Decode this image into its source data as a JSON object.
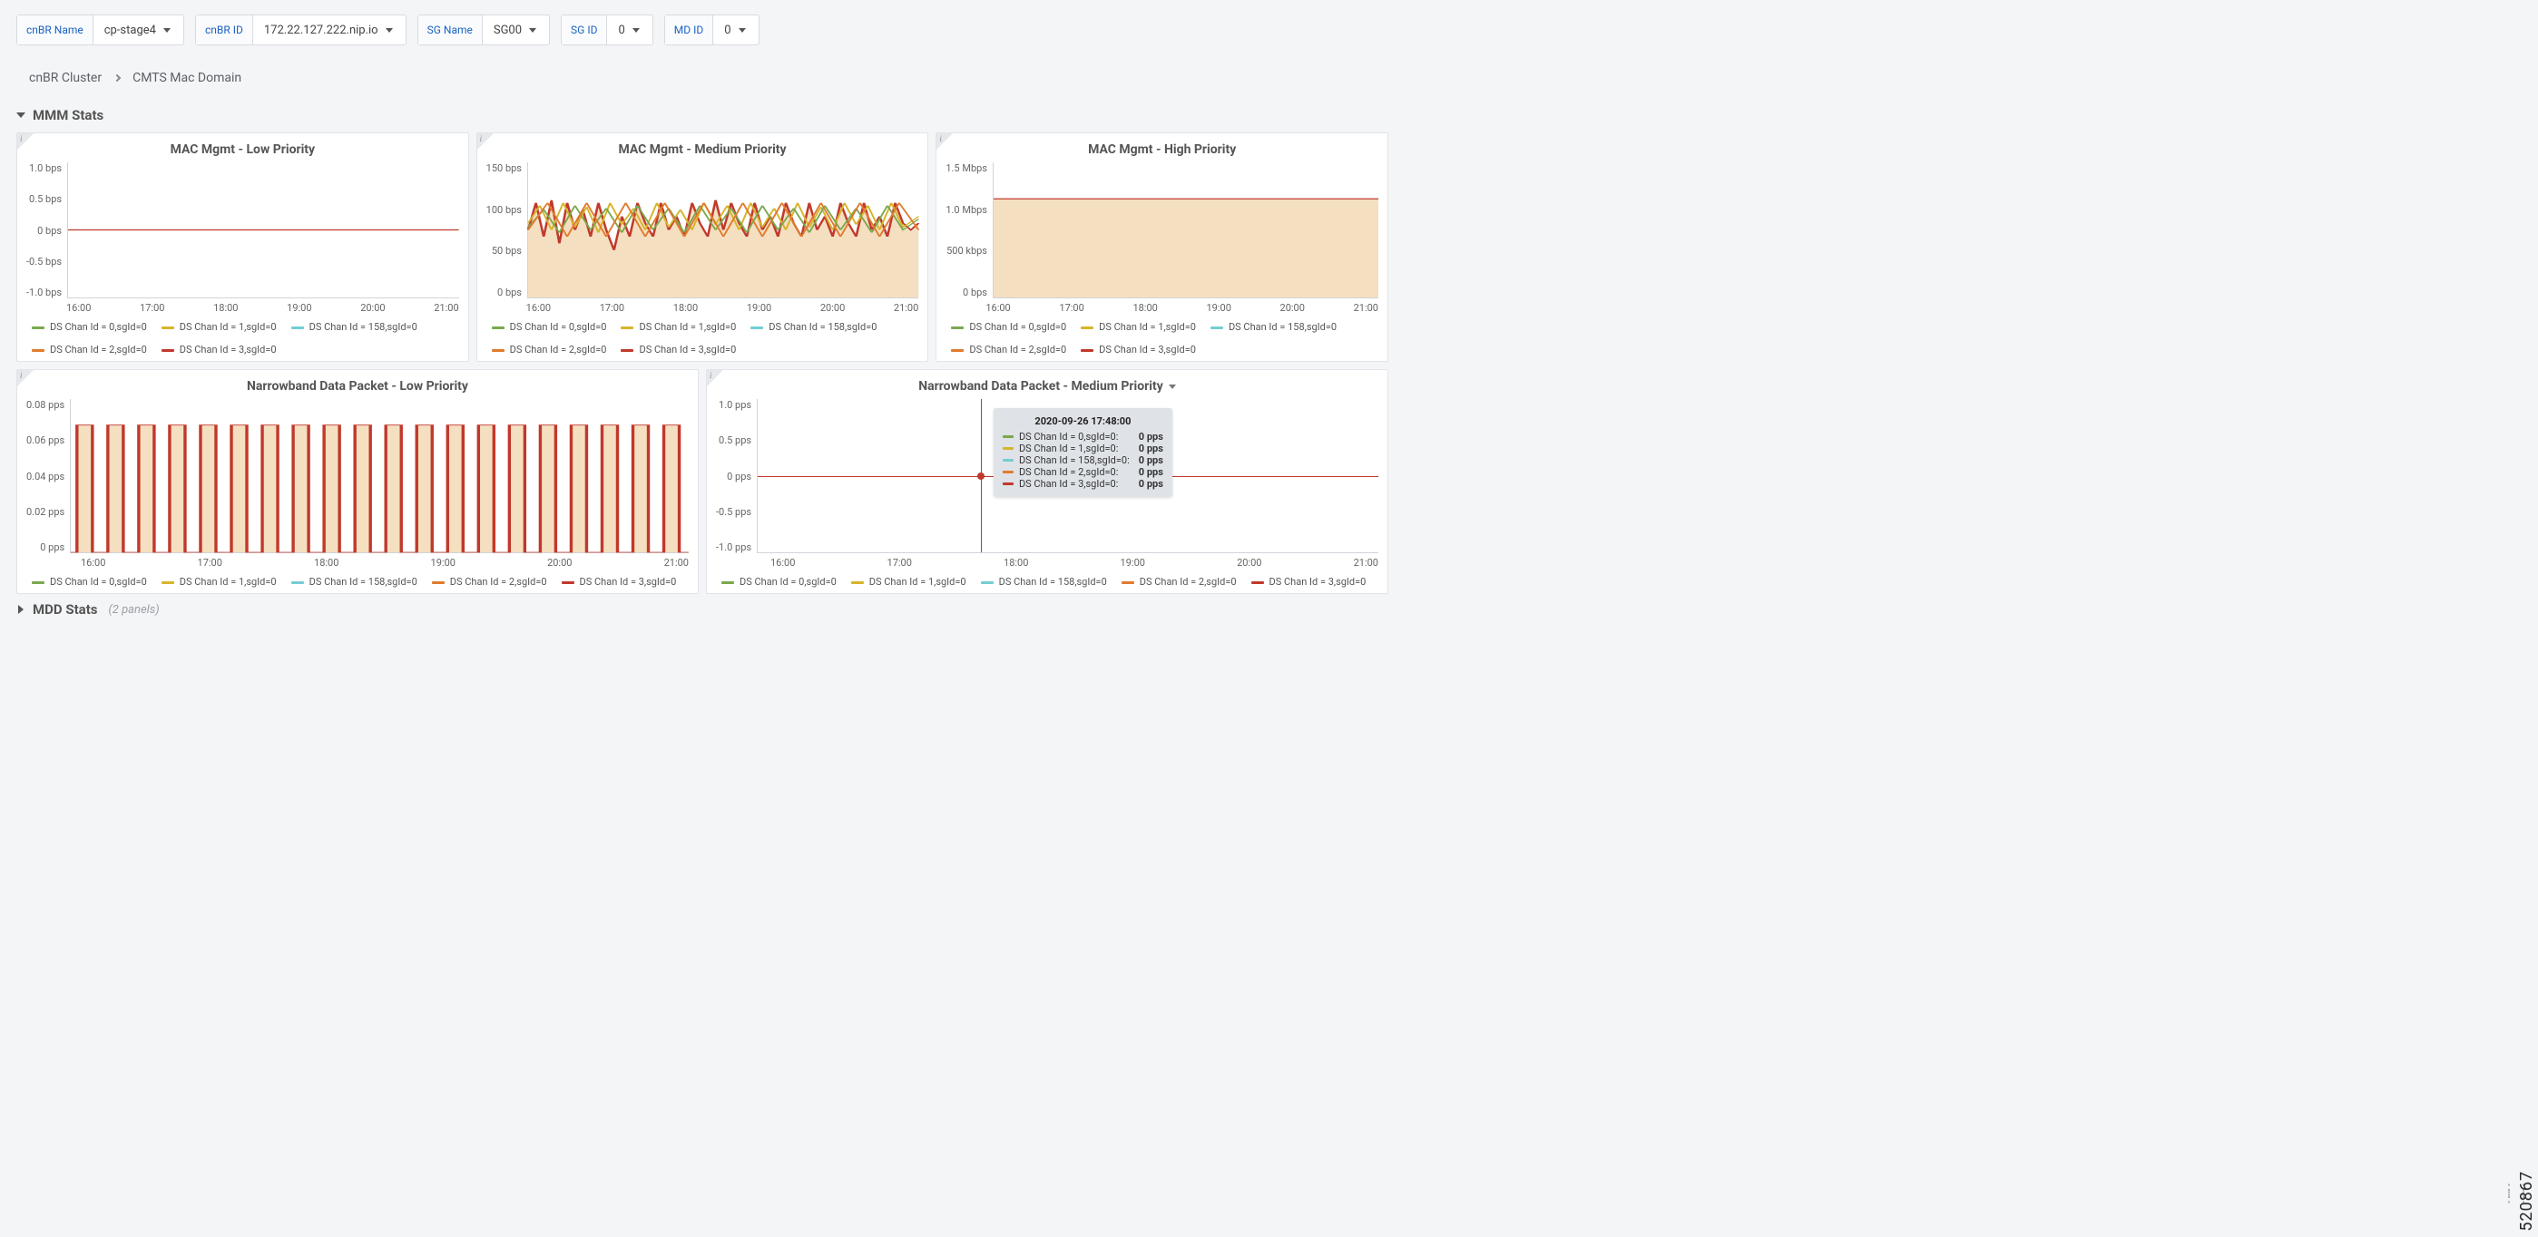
{
  "filters": {
    "cnbr_name_label": "cnBR Name",
    "cnbr_name_value": "cp-stage4",
    "cnbr_id_label": "cnBR ID",
    "cnbr_id_value": "172.22.127.222.nip.io",
    "sg_name_label": "SG Name",
    "sg_name_value": "SG00",
    "sg_id_label": "SG ID",
    "sg_id_value": "0",
    "md_id_label": "MD ID",
    "md_id_value": "0"
  },
  "breadcrumb": {
    "a": "cnBR Cluster",
    "b": "CMTS Mac Domain"
  },
  "sections": {
    "mmm": "MMM Stats",
    "mdd": "MDD Stats",
    "mdd_meta": "(2 panels)"
  },
  "legend_labels": [
    "DS Chan Id = 0,sgId=0",
    "DS Chan Id = 1,sgId=0",
    "DS Chan Id = 158,sgId=0",
    "DS Chan Id = 2,sgId=0",
    "DS Chan Id = 3,sgId=0"
  ],
  "legend_colors": [
    "#7aa84f",
    "#d6b52a",
    "#74cdd1",
    "#e07b2e",
    "#c0392b"
  ],
  "x_ticks": [
    "16:00",
    "17:00",
    "18:00",
    "19:00",
    "20:00",
    "21:00"
  ],
  "panels": {
    "low": {
      "title": "MAC Mgmt - Low Priority",
      "yticks": [
        "1.0 bps",
        "0.5 bps",
        "0 bps",
        "-0.5 bps",
        "-1.0 bps"
      ]
    },
    "med": {
      "title": "MAC Mgmt - Medium Priority",
      "yticks": [
        "150 bps",
        "100 bps",
        "50 bps",
        "0 bps"
      ]
    },
    "high": {
      "title": "MAC Mgmt - High Priority",
      "yticks": [
        "1.5 Mbps",
        "1.0 Mbps",
        "500 kbps",
        "0 bps"
      ]
    },
    "nblow": {
      "title": "Narrowband Data Packet - Low Priority",
      "yticks": [
        "0.08 pps",
        "0.06 pps",
        "0.04 pps",
        "0.02 pps",
        "0 pps"
      ]
    },
    "nbmed": {
      "title": "Narrowband Data Packet - Medium Priority",
      "yticks": [
        "1.0 pps",
        "0.5 pps",
        "0 pps",
        "-0.5 pps",
        "-1.0 pps"
      ]
    }
  },
  "tooltip": {
    "title": "2020-09-26 17:48:00",
    "rows": [
      {
        "label": "DS Chan Id = 0,sgId=0:",
        "value": "0 pps"
      },
      {
        "label": "DS Chan Id = 1,sgId=0:",
        "value": "0 pps"
      },
      {
        "label": "DS Chan Id = 158,sgId=0:",
        "value": "0 pps"
      },
      {
        "label": "DS Chan Id = 2,sgId=0:",
        "value": "0 pps"
      },
      {
        "label": "DS Chan Id = 3,sgId=0:",
        "value": "0 pps"
      }
    ]
  },
  "side_number": "520867",
  "chart_data": [
    {
      "type": "line",
      "title": "MAC Mgmt - Low Priority",
      "xlabel": "",
      "ylabel": "bps",
      "ylim": [
        -1,
        1
      ],
      "x_ticks": [
        "16:00",
        "17:00",
        "18:00",
        "19:00",
        "20:00",
        "21:00"
      ],
      "series": [
        {
          "name": "DS Chan Id = 0,sgId=0",
          "values": [
            0,
            0,
            0,
            0,
            0,
            0
          ]
        },
        {
          "name": "DS Chan Id = 1,sgId=0",
          "values": [
            0,
            0,
            0,
            0,
            0,
            0
          ]
        },
        {
          "name": "DS Chan Id = 158,sgId=0",
          "values": [
            0,
            0,
            0,
            0,
            0,
            0
          ]
        },
        {
          "name": "DS Chan Id = 2,sgId=0",
          "values": [
            0,
            0,
            0,
            0,
            0,
            0
          ]
        },
        {
          "name": "DS Chan Id = 3,sgId=0",
          "values": [
            0,
            0,
            0,
            0,
            0,
            0
          ]
        }
      ]
    },
    {
      "type": "line",
      "title": "MAC Mgmt - Medium Priority",
      "xlabel": "",
      "ylabel": "bps",
      "ylim": [
        0,
        150
      ],
      "x_ticks": [
        "16:00",
        "17:00",
        "18:00",
        "19:00",
        "20:00",
        "21:00"
      ],
      "note": "values oscillate roughly between 50 and 115 bps across all series; estimated samples at hour marks",
      "series": [
        {
          "name": "DS Chan Id = 0,sgId=0",
          "values": [
            70,
            85,
            80,
            90,
            80,
            85
          ]
        },
        {
          "name": "DS Chan Id = 1,sgId=0",
          "values": [
            80,
            90,
            85,
            95,
            85,
            90
          ]
        },
        {
          "name": "DS Chan Id = 158,sgId=0",
          "values": [
            75,
            80,
            80,
            85,
            80,
            80
          ]
        },
        {
          "name": "DS Chan Id = 2,sgId=0",
          "values": [
            70,
            85,
            80,
            90,
            80,
            85
          ]
        },
        {
          "name": "DS Chan Id = 3,sgId=0",
          "values": [
            60,
            80,
            75,
            85,
            75,
            80
          ]
        }
      ]
    },
    {
      "type": "area",
      "title": "MAC Mgmt - High Priority",
      "xlabel": "",
      "ylabel": "",
      "ylim": [
        0,
        1500000
      ],
      "y_ticks_display": [
        "1.5 Mbps",
        "1.0 Mbps",
        "500 kbps",
        "0 bps"
      ],
      "x_ticks": [
        "16:00",
        "17:00",
        "18:00",
        "19:00",
        "20:00",
        "21:00"
      ],
      "series": [
        {
          "name": "DS Chan Id = 0,sgId=0",
          "values": [
            1100000,
            1100000,
            1100000,
            1100000,
            1100000,
            1100000
          ]
        },
        {
          "name": "DS Chan Id = 1,sgId=0",
          "values": [
            1100000,
            1100000,
            1100000,
            1100000,
            1100000,
            1100000
          ]
        },
        {
          "name": "DS Chan Id = 158,sgId=0",
          "values": [
            1100000,
            1100000,
            1100000,
            1100000,
            1100000,
            1100000
          ]
        },
        {
          "name": "DS Chan Id = 2,sgId=0",
          "values": [
            1100000,
            1100000,
            1100000,
            1100000,
            1100000,
            1100000
          ]
        },
        {
          "name": "DS Chan Id = 3,sgId=0",
          "values": [
            1100000,
            1100000,
            1100000,
            1100000,
            1100000,
            1100000
          ]
        }
      ]
    },
    {
      "type": "area",
      "title": "Narrowband Data Packet - Low Priority",
      "xlabel": "",
      "ylabel": "pps",
      "ylim": [
        0,
        0.08
      ],
      "x_ticks": [
        "16:00",
        "17:00",
        "18:00",
        "19:00",
        "20:00",
        "21:00"
      ],
      "note": "pulse train alternating approx 0 and 0.067 pps; representative alternating samples",
      "series": [
        {
          "name": "DS Chan Id = 0,sgId=0",
          "values": [
            0.067,
            0,
            0.067,
            0,
            0.067,
            0,
            0.067,
            0,
            0.067,
            0,
            0.067,
            0
          ]
        },
        {
          "name": "DS Chan Id = 1,sgId=0",
          "values": [
            0.067,
            0,
            0.067,
            0,
            0.067,
            0,
            0.067,
            0,
            0.067,
            0,
            0.067,
            0
          ]
        },
        {
          "name": "DS Chan Id = 158,sgId=0",
          "values": [
            0.067,
            0,
            0.067,
            0,
            0.067,
            0,
            0.067,
            0,
            0.067,
            0,
            0.067,
            0
          ]
        },
        {
          "name": "DS Chan Id = 2,sgId=0",
          "values": [
            0.067,
            0,
            0.067,
            0,
            0.067,
            0,
            0.067,
            0,
            0.067,
            0,
            0.067,
            0
          ]
        },
        {
          "name": "DS Chan Id = 3,sgId=0",
          "values": [
            0.067,
            0,
            0.067,
            0,
            0.067,
            0,
            0.067,
            0,
            0.067,
            0,
            0.067,
            0
          ]
        }
      ]
    },
    {
      "type": "line",
      "title": "Narrowband Data Packet - Medium Priority",
      "xlabel": "",
      "ylabel": "pps",
      "ylim": [
        -1,
        1
      ],
      "x_ticks": [
        "16:00",
        "17:00",
        "18:00",
        "19:00",
        "20:00",
        "21:00"
      ],
      "hover_time": "2020-09-26 17:48:00",
      "series": [
        {
          "name": "DS Chan Id = 0,sgId=0",
          "values": [
            0,
            0,
            0,
            0,
            0,
            0
          ]
        },
        {
          "name": "DS Chan Id = 1,sgId=0",
          "values": [
            0,
            0,
            0,
            0,
            0,
            0
          ]
        },
        {
          "name": "DS Chan Id = 158,sgId=0",
          "values": [
            0,
            0,
            0,
            0,
            0,
            0
          ]
        },
        {
          "name": "DS Chan Id = 2,sgId=0",
          "values": [
            0,
            0,
            0,
            0,
            0,
            0
          ]
        },
        {
          "name": "DS Chan Id = 3,sgId=0",
          "values": [
            0,
            0,
            0,
            0,
            0,
            0
          ]
        }
      ]
    }
  ]
}
